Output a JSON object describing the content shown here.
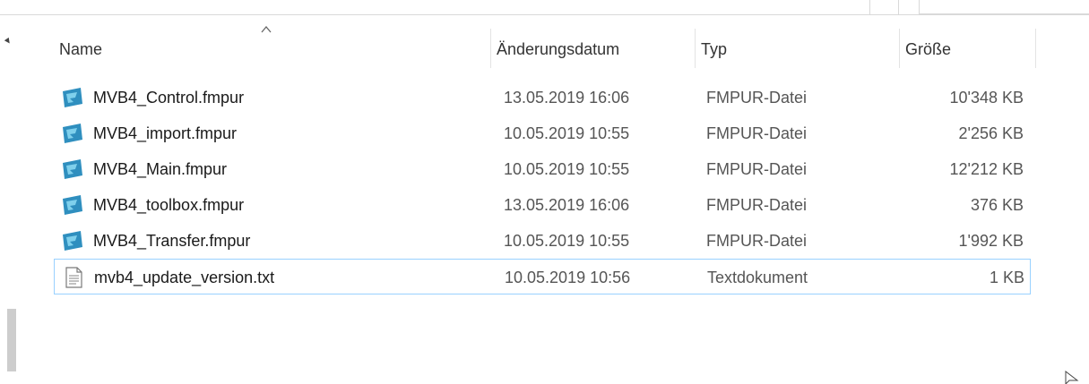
{
  "columns": {
    "name": "Name",
    "date": "Änderungsdatum",
    "type": "Typ",
    "size": "Größe"
  },
  "files": [
    {
      "name": "MVB4_Control.fmpur",
      "date": "13.05.2019 16:06",
      "type": "FMPUR-Datei",
      "size": "10'348 KB",
      "icon": "filemaker-icon"
    },
    {
      "name": "MVB4_import.fmpur",
      "date": "10.05.2019 10:55",
      "type": "FMPUR-Datei",
      "size": "2'256 KB",
      "icon": "filemaker-icon"
    },
    {
      "name": "MVB4_Main.fmpur",
      "date": "10.05.2019 10:55",
      "type": "FMPUR-Datei",
      "size": "12'212 KB",
      "icon": "filemaker-icon"
    },
    {
      "name": "MVB4_toolbox.fmpur",
      "date": "13.05.2019 16:06",
      "type": "FMPUR-Datei",
      "size": "376 KB",
      "icon": "filemaker-icon"
    },
    {
      "name": "MVB4_Transfer.fmpur",
      "date": "10.05.2019 10:55",
      "type": "FMPUR-Datei",
      "size": "1'992 KB",
      "icon": "filemaker-icon"
    },
    {
      "name": "mvb4_update_version.txt",
      "date": "10.05.2019 10:56",
      "type": "Textdokument",
      "size": "1 KB",
      "icon": "text-document-icon"
    }
  ],
  "selected_index": 5,
  "colors": {
    "selection_border": "#99d1ff",
    "icon_primary": "#2f8fbf",
    "icon_accent": "#7fd0ec"
  }
}
